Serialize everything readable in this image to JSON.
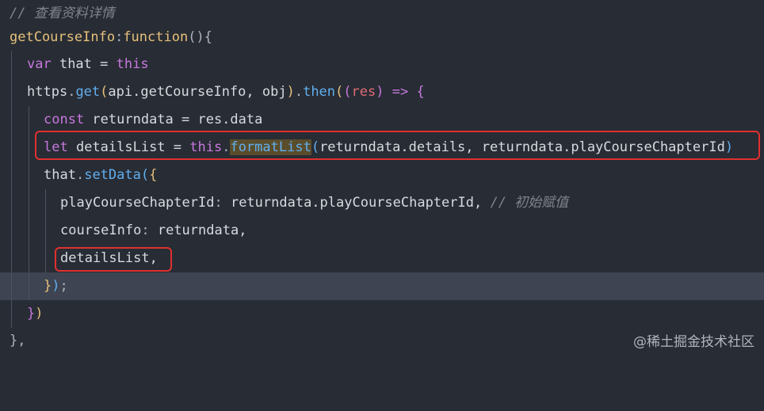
{
  "editor": {
    "lines": [
      {
        "comment": "// 查看资料详情"
      },
      {
        "name": "getCourseInfo",
        "colon": ":",
        "kw": "function",
        "tail": "(){"
      },
      {
        "kw": "var",
        "rest": " that = ",
        "this": "this"
      },
      {
        "obj": "https",
        "dot": ".",
        "fn": "get",
        "open": "(",
        "args": "api.getCourseInfo, obj",
        "close": ")",
        "dot2": ".",
        "fn2": "then",
        "p1": "(",
        "p2": "(",
        "param": "res",
        "p3": ")",
        "arrow": " => ",
        "brace": "{"
      },
      {
        "kw": "const",
        "rest": " returndata = res.data"
      },
      {
        "kw": "let",
        "rest": " detailsList = ",
        "this": "this",
        "dot": ".",
        "fn": "formatList",
        "open": "(",
        "args": "returndata.details, returndata.playCourseChapterId",
        "close": ")"
      },
      {
        "obj": "that",
        "dot": ".",
        "fn": "setData",
        "open": "(",
        "brace": "{"
      },
      {
        "key": "playCourseChapterId",
        "colon": ":",
        "rest": " returndata.playCourseChapterId,",
        "comment": " // 初始赋值"
      },
      {
        "key": "courseInfo",
        "colon": ":",
        "rest": " returndata,"
      },
      {
        "text": "detailsList,"
      },
      {
        "brace": "}",
        "paren": ")",
        "semi": ";"
      },
      {
        "brace": "}",
        "paren": ")"
      },
      {
        "text": "},"
      }
    ]
  },
  "watermark": "@稀土掘金技术社区",
  "colors": {
    "background": "#282c34",
    "active_line": "#3e4451",
    "highlight_box": "#e03030"
  }
}
